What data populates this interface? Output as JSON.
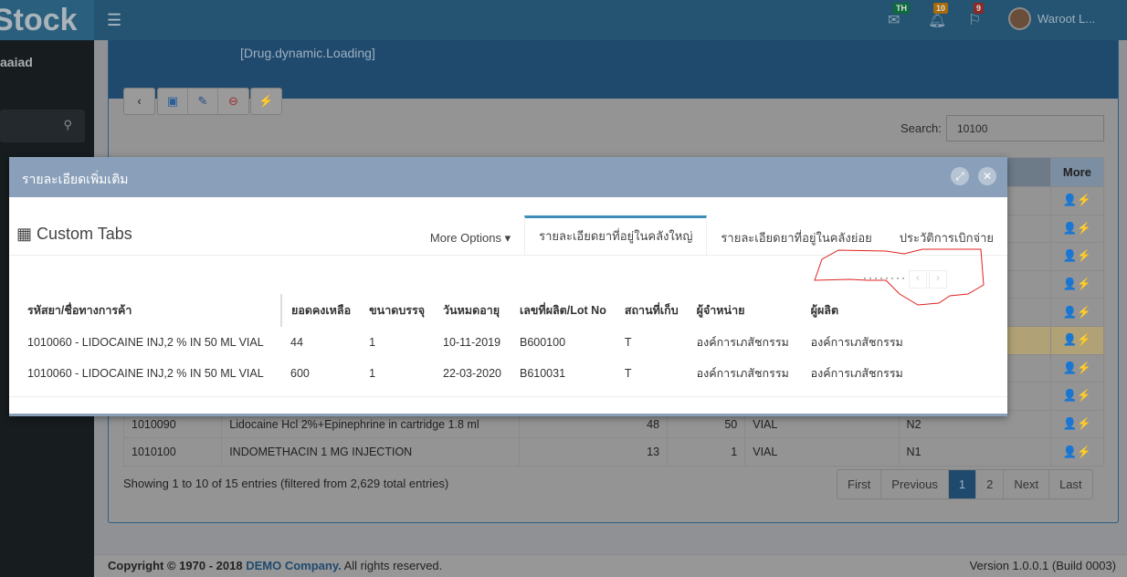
{
  "app": {
    "logo": "Stock",
    "user_name": "Waroot L..."
  },
  "topbar": {
    "mail_badge": "TH",
    "bell_badge": "10",
    "flag_badge": "9",
    "colors": {
      "mail": "#0d6b3c",
      "bell": "#a86a0b",
      "flag": "#8e2a26"
    }
  },
  "sidebar": {
    "user_label": "aaiad"
  },
  "box": {
    "title": "[Drug.dynamic.Loading]"
  },
  "search": {
    "label": "Search:",
    "value": "10100"
  },
  "bg_table": {
    "more_header": "More",
    "rows": [
      {
        "code": "1010090",
        "name": "Lidocaine Hcl 2%+Epinephrine in cartridge 1.8 ml",
        "qty": "48",
        "pack": "50",
        "unit": "VIAL",
        "loc": "N2"
      },
      {
        "code": "1010100",
        "name": "INDOMETHACIN 1 MG INJECTION",
        "qty": "13",
        "pack": "1",
        "unit": "VIAL",
        "loc": "N1"
      }
    ]
  },
  "info": "Showing 1 to 10 of 15 entries (filtered from 2,629 total entries)",
  "pager": [
    "First",
    "Previous",
    "1",
    "2",
    "Next",
    "Last"
  ],
  "footer": {
    "copyright": "Copyright © 1970 - 2018",
    "company": "DEMO Company.",
    "rights": "All rights reserved.",
    "version": "Version 1.0.0.1 (Build 0003)"
  },
  "modal": {
    "title": "รายละเอียดเพิ่มเติม",
    "custom_tabs": "Custom Tabs",
    "tabs": [
      "More Options",
      "รายละเอียดยาที่อยู่ในคลังใหญ่",
      "รายละเอียดยาที่อยู่ในคลังย่อย",
      "ประวัติการเบิกจ่าย"
    ],
    "headers": [
      "รหัสยา/ชื่อทางการค้า",
      "ยอดคงเหลือ",
      "ขนาดบรรจุ",
      "วันหมดอายุ",
      "เลขที่ผลิต/Lot No",
      "สถานที่เก็บ",
      "ผู้จำหน่าย",
      "ผู้ผลิต"
    ],
    "rows": [
      [
        "1010060 - LIDOCAINE INJ,2 % IN 50 ML VIAL",
        "44",
        "1",
        "10-11-2019",
        "B600100",
        "T",
        "องค์การเภสัชกรรม",
        "องค์การเภสัชกรรม"
      ],
      [
        "1010060 - LIDOCAINE INJ,2 % IN 50 ML VIAL",
        "600",
        "1",
        "22-03-2020",
        "B610031",
        "T",
        "องค์การเภสัชกรรม",
        "องค์การเภสัชกรรม"
      ]
    ]
  }
}
